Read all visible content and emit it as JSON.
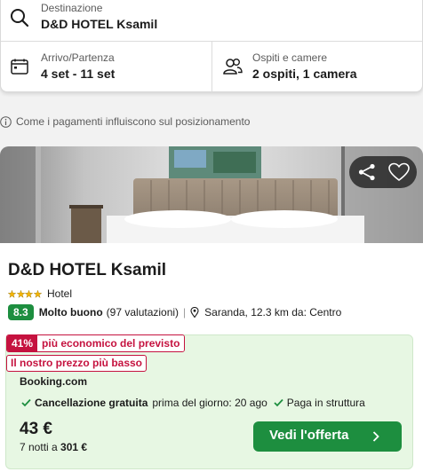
{
  "search": {
    "destination_label": "Destinazione",
    "destination_value": "D&D HOTEL Ksamil",
    "dates_label": "Arrivo/Partenza",
    "dates_value": "4 set - 11 set",
    "guests_label": "Ospiti e camere",
    "guests_value": "2 ospiti, 1 camera",
    "icons": {
      "destination": "search-icon",
      "dates": "calendar-icon",
      "guests": "guests-icon"
    }
  },
  "payment_info_text": "Come i pagamenti influiscono sul posizionamento",
  "hotel": {
    "name": "D&D HOTEL Ksamil",
    "stars": 4,
    "type": "Hotel",
    "rating_score": "8.3",
    "rating_word": "Molto buono",
    "rating_count": "(97 valutazioni)",
    "location": "Saranda, 12.3 km da: Centro"
  },
  "deal": {
    "discount_percent": "41%",
    "discount_text": "più economico del previsto",
    "best_price_label": "Il nostro prezzo più basso",
    "provider": "Booking.com",
    "free_cancel": "Cancellazione gratuita",
    "free_cancel_detail": "prima del giorno: 20 ago",
    "pay_at_property": "Paga in struttura",
    "price": "43 €",
    "nights_prefix": "7 notti a",
    "total_price": "301 €",
    "cta_label": "Vedi l'offerta"
  },
  "colors": {
    "accent_green": "#1d8e3f",
    "deal_background": "#e7f7e3",
    "discount_red": "#c5123f",
    "star_yellow": "#f5b400"
  }
}
